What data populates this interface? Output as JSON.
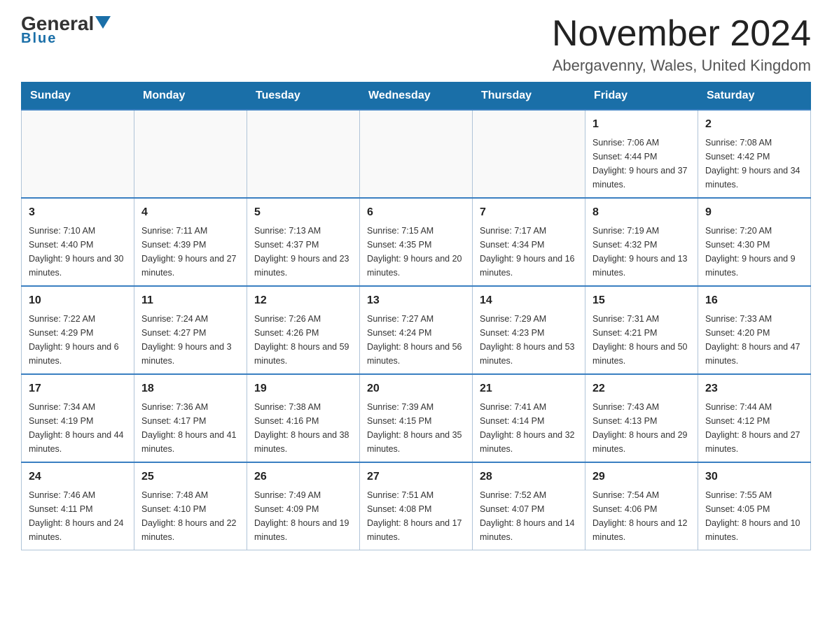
{
  "header": {
    "logo_main": "General",
    "logo_sub": "Blue",
    "title": "November 2024",
    "subtitle": "Abergavenny, Wales, United Kingdom"
  },
  "weekdays": [
    "Sunday",
    "Monday",
    "Tuesday",
    "Wednesday",
    "Thursday",
    "Friday",
    "Saturday"
  ],
  "weeks": [
    [
      {
        "day": "",
        "info": ""
      },
      {
        "day": "",
        "info": ""
      },
      {
        "day": "",
        "info": ""
      },
      {
        "day": "",
        "info": ""
      },
      {
        "day": "",
        "info": ""
      },
      {
        "day": "1",
        "info": "Sunrise: 7:06 AM\nSunset: 4:44 PM\nDaylight: 9 hours and 37 minutes."
      },
      {
        "day": "2",
        "info": "Sunrise: 7:08 AM\nSunset: 4:42 PM\nDaylight: 9 hours and 34 minutes."
      }
    ],
    [
      {
        "day": "3",
        "info": "Sunrise: 7:10 AM\nSunset: 4:40 PM\nDaylight: 9 hours and 30 minutes."
      },
      {
        "day": "4",
        "info": "Sunrise: 7:11 AM\nSunset: 4:39 PM\nDaylight: 9 hours and 27 minutes."
      },
      {
        "day": "5",
        "info": "Sunrise: 7:13 AM\nSunset: 4:37 PM\nDaylight: 9 hours and 23 minutes."
      },
      {
        "day": "6",
        "info": "Sunrise: 7:15 AM\nSunset: 4:35 PM\nDaylight: 9 hours and 20 minutes."
      },
      {
        "day": "7",
        "info": "Sunrise: 7:17 AM\nSunset: 4:34 PM\nDaylight: 9 hours and 16 minutes."
      },
      {
        "day": "8",
        "info": "Sunrise: 7:19 AM\nSunset: 4:32 PM\nDaylight: 9 hours and 13 minutes."
      },
      {
        "day": "9",
        "info": "Sunrise: 7:20 AM\nSunset: 4:30 PM\nDaylight: 9 hours and 9 minutes."
      }
    ],
    [
      {
        "day": "10",
        "info": "Sunrise: 7:22 AM\nSunset: 4:29 PM\nDaylight: 9 hours and 6 minutes."
      },
      {
        "day": "11",
        "info": "Sunrise: 7:24 AM\nSunset: 4:27 PM\nDaylight: 9 hours and 3 minutes."
      },
      {
        "day": "12",
        "info": "Sunrise: 7:26 AM\nSunset: 4:26 PM\nDaylight: 8 hours and 59 minutes."
      },
      {
        "day": "13",
        "info": "Sunrise: 7:27 AM\nSunset: 4:24 PM\nDaylight: 8 hours and 56 minutes."
      },
      {
        "day": "14",
        "info": "Sunrise: 7:29 AM\nSunset: 4:23 PM\nDaylight: 8 hours and 53 minutes."
      },
      {
        "day": "15",
        "info": "Sunrise: 7:31 AM\nSunset: 4:21 PM\nDaylight: 8 hours and 50 minutes."
      },
      {
        "day": "16",
        "info": "Sunrise: 7:33 AM\nSunset: 4:20 PM\nDaylight: 8 hours and 47 minutes."
      }
    ],
    [
      {
        "day": "17",
        "info": "Sunrise: 7:34 AM\nSunset: 4:19 PM\nDaylight: 8 hours and 44 minutes."
      },
      {
        "day": "18",
        "info": "Sunrise: 7:36 AM\nSunset: 4:17 PM\nDaylight: 8 hours and 41 minutes."
      },
      {
        "day": "19",
        "info": "Sunrise: 7:38 AM\nSunset: 4:16 PM\nDaylight: 8 hours and 38 minutes."
      },
      {
        "day": "20",
        "info": "Sunrise: 7:39 AM\nSunset: 4:15 PM\nDaylight: 8 hours and 35 minutes."
      },
      {
        "day": "21",
        "info": "Sunrise: 7:41 AM\nSunset: 4:14 PM\nDaylight: 8 hours and 32 minutes."
      },
      {
        "day": "22",
        "info": "Sunrise: 7:43 AM\nSunset: 4:13 PM\nDaylight: 8 hours and 29 minutes."
      },
      {
        "day": "23",
        "info": "Sunrise: 7:44 AM\nSunset: 4:12 PM\nDaylight: 8 hours and 27 minutes."
      }
    ],
    [
      {
        "day": "24",
        "info": "Sunrise: 7:46 AM\nSunset: 4:11 PM\nDaylight: 8 hours and 24 minutes."
      },
      {
        "day": "25",
        "info": "Sunrise: 7:48 AM\nSunset: 4:10 PM\nDaylight: 8 hours and 22 minutes."
      },
      {
        "day": "26",
        "info": "Sunrise: 7:49 AM\nSunset: 4:09 PM\nDaylight: 8 hours and 19 minutes."
      },
      {
        "day": "27",
        "info": "Sunrise: 7:51 AM\nSunset: 4:08 PM\nDaylight: 8 hours and 17 minutes."
      },
      {
        "day": "28",
        "info": "Sunrise: 7:52 AM\nSunset: 4:07 PM\nDaylight: 8 hours and 14 minutes."
      },
      {
        "day": "29",
        "info": "Sunrise: 7:54 AM\nSunset: 4:06 PM\nDaylight: 8 hours and 12 minutes."
      },
      {
        "day": "30",
        "info": "Sunrise: 7:55 AM\nSunset: 4:05 PM\nDaylight: 8 hours and 10 minutes."
      }
    ]
  ],
  "colors": {
    "header_bg": "#1a6fa8",
    "header_text": "#ffffff",
    "border": "#b0c4d8",
    "row_border": "#3a7fc1"
  }
}
